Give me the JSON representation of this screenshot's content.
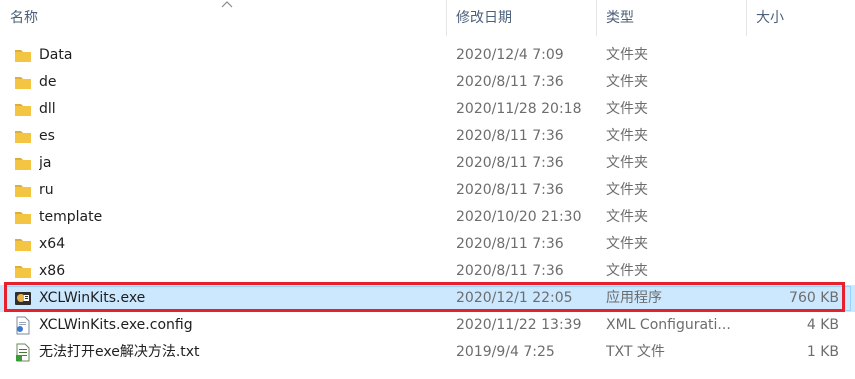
{
  "columns": {
    "name": "名称",
    "date": "修改日期",
    "type": "类型",
    "size": "大小"
  },
  "sort_indicator": "chevron-up-icon",
  "files": [
    {
      "name": "Data",
      "date": "2020/12/4 7:09",
      "type": "文件夹",
      "size": "",
      "icon": "folder-icon"
    },
    {
      "name": "de",
      "date": "2020/8/11 7:36",
      "type": "文件夹",
      "size": "",
      "icon": "folder-icon"
    },
    {
      "name": "dll",
      "date": "2020/11/28 20:18",
      "type": "文件夹",
      "size": "",
      "icon": "folder-icon"
    },
    {
      "name": "es",
      "date": "2020/8/11 7:36",
      "type": "文件夹",
      "size": "",
      "icon": "folder-icon"
    },
    {
      "name": "ja",
      "date": "2020/8/11 7:36",
      "type": "文件夹",
      "size": "",
      "icon": "folder-icon"
    },
    {
      "name": "ru",
      "date": "2020/8/11 7:36",
      "type": "文件夹",
      "size": "",
      "icon": "folder-icon"
    },
    {
      "name": "template",
      "date": "2020/10/20 21:30",
      "type": "文件夹",
      "size": "",
      "icon": "folder-icon"
    },
    {
      "name": "x64",
      "date": "2020/8/11 7:36",
      "type": "文件夹",
      "size": "",
      "icon": "folder-icon"
    },
    {
      "name": "x86",
      "date": "2020/8/11 7:36",
      "type": "文件夹",
      "size": "",
      "icon": "folder-icon"
    },
    {
      "name": "XCLWinKits.exe",
      "date": "2020/12/1 22:05",
      "type": "应用程序",
      "size": "760 KB",
      "icon": "application-icon"
    },
    {
      "name": "XCLWinKits.exe.config",
      "date": "2020/11/22 13:39",
      "type": "XML Configurati...",
      "size": "4 KB",
      "icon": "config-file-icon"
    },
    {
      "name": "无法打开exe解决方法.txt",
      "date": "2019/9/4 7:25",
      "type": "TXT 文件",
      "size": "1 KB",
      "icon": "text-file-icon"
    }
  ],
  "selected_file": "XCLWinKits.exe",
  "colors": {
    "header_text": "#4c607a",
    "selection_bg": "#cce8ff",
    "highlight_border": "#e8202b",
    "folder": "#f4c542"
  }
}
